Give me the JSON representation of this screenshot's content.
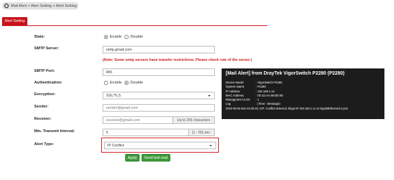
{
  "breadcrumb": {
    "text": "Mail Alert > Alert Setting > Alert Setting"
  },
  "tab": {
    "label": "Alert Setting"
  },
  "state": {
    "label": "State:",
    "enable": "Enable",
    "disable": "Disable",
    "selected": "Enable"
  },
  "smtp_server": {
    "label": "SMTP Server:",
    "value": "smtp.gmail.com",
    "note": "(Note: Some smtp servers have transfer restrictions. Please check rule of the server.)"
  },
  "smtp_port": {
    "label": "SMTP Port:",
    "value": "465"
  },
  "authentication": {
    "label": "Authentication:",
    "enable": "Enable",
    "disable": "Disable",
    "selected": "Disable"
  },
  "encryption": {
    "label": "Encryption:",
    "value": "SSL/TLS"
  },
  "sender": {
    "label": "Sender:",
    "value": "sender@gmail.com"
  },
  "receiver": {
    "label": "Receiver:",
    "value": "receiver@gmail.com",
    "hint": "Up to 255 characters"
  },
  "interval": {
    "label": "Min. Transmit Interval:",
    "value": "5",
    "unit": "(1 - 60) sec."
  },
  "alert_type": {
    "label": "Alert Type:",
    "value": "IP Conflict"
  },
  "buttons": {
    "apply": "Apply",
    "send_test": "Send test mail"
  },
  "mail_preview": {
    "title": "[Mail Alert] from DrayTek VigorSwitch P2280 (P2280)",
    "rows": [
      {
        "key": "Device Model",
        "value": ": VigorSwitch P2280"
      },
      {
        "key": "System Name",
        "value": ": P2280"
      },
      {
        "key": "IP Address",
        "value": ": 192.168.1.14"
      },
      {
        "key": "MAC Address",
        "value": ": 00:1D:AA:0E:B0:08"
      },
      {
        "key": "Managment VLAN",
        "value": ": 1"
      },
      {
        "key": "Log",
        "value": ": (Time : Message)"
      }
    ],
    "log_line": "2019-05-06 Mon 02:26:43; ICP: Conflict detected, illegal IP 192.168.1.11 at GigabitEthernet14 port."
  },
  "colors": {
    "accent_red": "#c8141a",
    "button_green": "#3e9a3a",
    "panel_bg": "#1c1c1c"
  }
}
